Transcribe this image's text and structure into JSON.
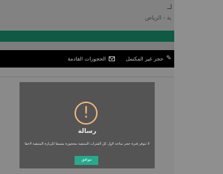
{
  "header": {
    "location": "ية - الرياض"
  },
  "nav": {
    "items": [
      {
        "label": "حجز غير المكتمل",
        "icon": "edit-icon"
      },
      {
        "label": "الحجوزات القادمة",
        "icon": "envelope-icon"
      }
    ]
  },
  "modal": {
    "icon": "exclamation-icon",
    "icon_glyph": "!",
    "title": "رسالة",
    "message": "لا تتوفر فترة حجز متاحة لأول كل الفترات المتبقية محجوزة مسبقاً للزيارة المتبقية لاحقاً",
    "ok_label": "موافق"
  },
  "colors": {
    "brand_green": "#0e5a44",
    "button": "#26a98c",
    "alert_accent": "#f2b97d"
  }
}
